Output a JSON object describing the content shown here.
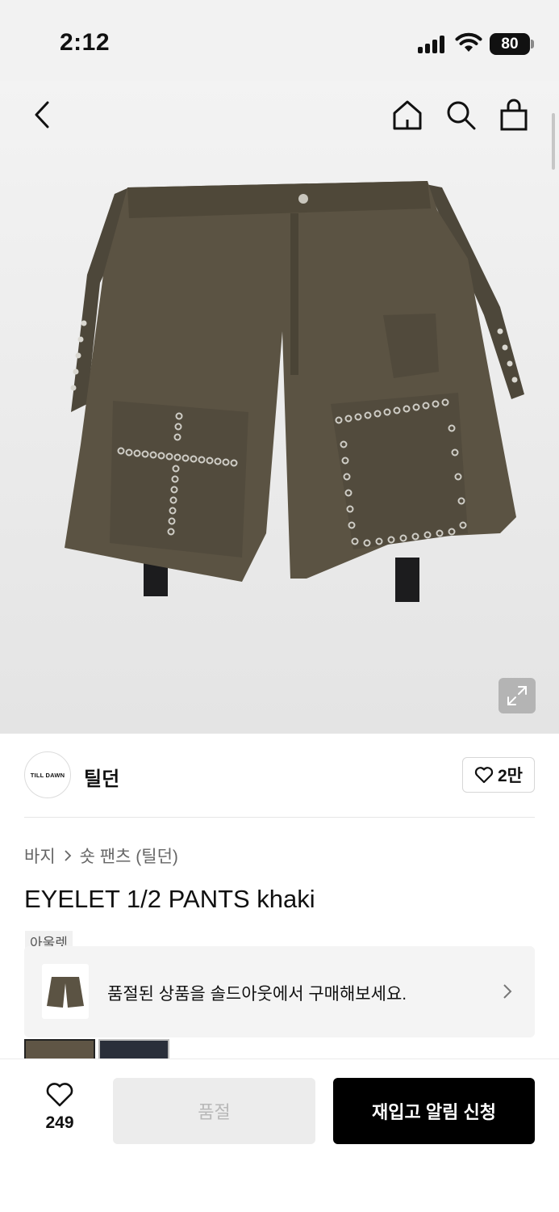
{
  "status_bar": {
    "time": "2:12",
    "battery": "80"
  },
  "header": {
    "back_icon": "chevron-left-icon",
    "home_icon": "home-icon",
    "search_icon": "search-icon",
    "bag_icon": "shopping-bag-icon"
  },
  "product_image": {
    "expand_icon": "expand-icon"
  },
  "brand": {
    "logo_text": "TILL DAWN",
    "name": "틸던",
    "like_count": "2만"
  },
  "breadcrumb": {
    "category": "바지",
    "subcategory": "숏 팬츠 (틸던)"
  },
  "product": {
    "title": "EYELET 1/2 PANTS khaki",
    "tag": "아울렛"
  },
  "soldout_banner": {
    "text": "품절된 상품을 솔드아웃에서 구매해보세요."
  },
  "bottom_bar": {
    "wish_count": "249",
    "soldout_label": "품절",
    "restock_label": "재입고 알림 신청"
  },
  "colors": {
    "accent": "#000000",
    "product_khaki": "#5b5343",
    "banner_bg": "#f4f4f4"
  }
}
